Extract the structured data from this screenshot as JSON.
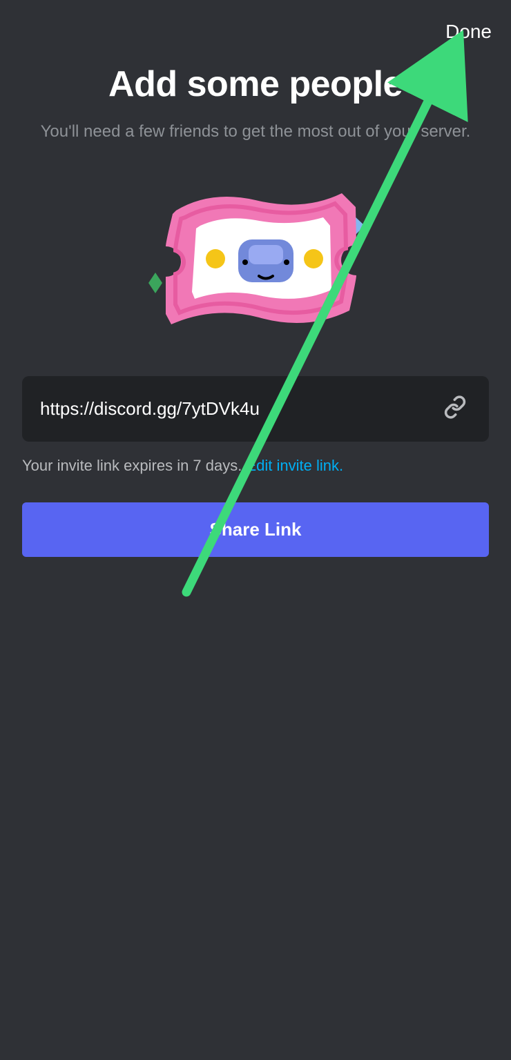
{
  "header": {
    "done_label": "Done"
  },
  "title": "Add some people",
  "subtitle": "You'll need a few friends to get the most out of your server.",
  "invite": {
    "url": "https://discord.gg/7ytDVk4u",
    "expire_text": "Your invite link expires in 7 days. ",
    "edit_link_label": "Edit invite link."
  },
  "share_button_label": "Share Link"
}
